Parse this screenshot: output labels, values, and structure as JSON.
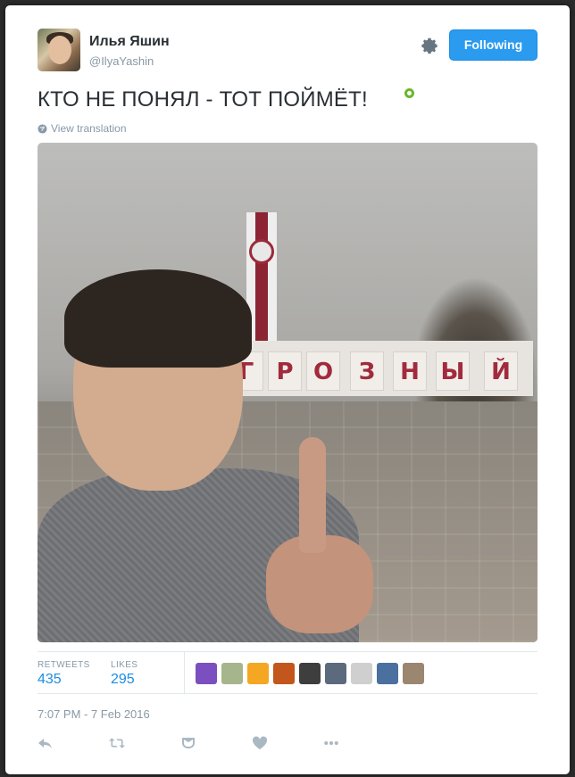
{
  "user": {
    "display_name": "Илья Яшин",
    "screen_name": "@IlyaYashin"
  },
  "follow_button": {
    "label": "Following"
  },
  "tweet": {
    "text": "КТО НЕ ПОНЯЛ - ТОТ ПОЙМЁТ!",
    "view_translation": "View translation",
    "timestamp": "7:07 PM - 7 Feb 2016"
  },
  "photo": {
    "sign_letters": [
      "Г",
      "Р",
      "О",
      "З",
      "Н",
      "Ы",
      "Й"
    ]
  },
  "stats": {
    "retweets_label": "RETWEETS",
    "retweets_value": "435",
    "likes_label": "LIKES",
    "likes_value": "295"
  },
  "likers": [
    {
      "name": "liker-1",
      "color": "#7b4fbf"
    },
    {
      "name": "liker-2",
      "color": "#a7b58c"
    },
    {
      "name": "liker-3",
      "color": "#f5a623"
    },
    {
      "name": "liker-4",
      "color": "#c2561c"
    },
    {
      "name": "liker-5",
      "color": "#3e3e3e"
    },
    {
      "name": "liker-6",
      "color": "#5c6a7e"
    },
    {
      "name": "liker-7",
      "color": "#cfcfcf"
    },
    {
      "name": "liker-8",
      "color": "#4b6f9e"
    },
    {
      "name": "liker-9",
      "color": "#9b8670"
    }
  ],
  "icons": {
    "settings": "gear-icon",
    "reply": "reply-icon",
    "retweet": "retweet-icon",
    "dm": "direct-message-icon",
    "like": "heart-icon",
    "more": "more-icon",
    "globe": "globe-icon"
  },
  "colors": {
    "accent": "#2b9bf0",
    "text": "#292f33",
    "muted": "#8899a6",
    "link": "#1b8de3",
    "action_icon": "#aab8c2"
  }
}
